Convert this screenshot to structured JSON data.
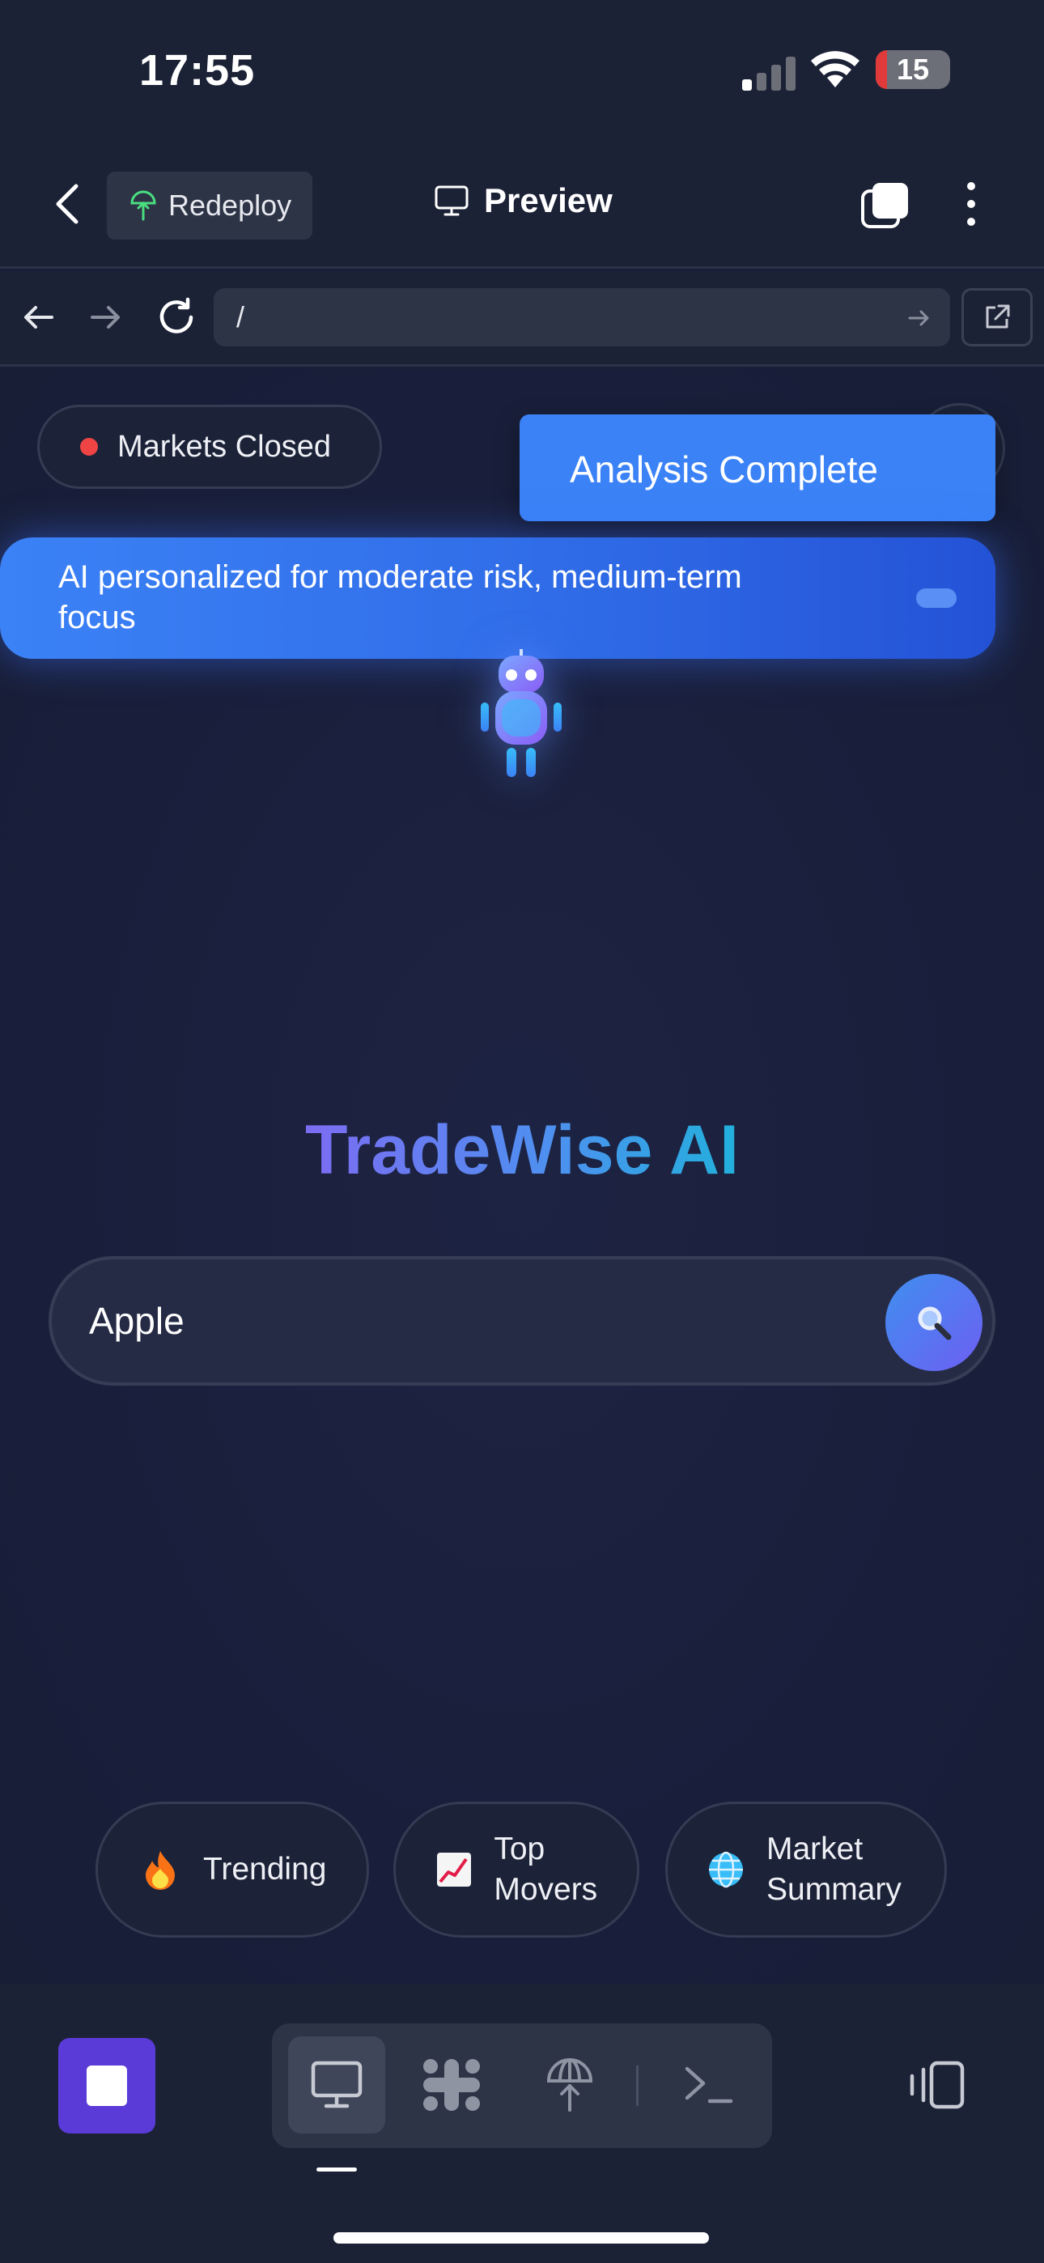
{
  "status_bar": {
    "time": "17:55",
    "battery_percent": "15"
  },
  "header": {
    "redeploy_label": "Redeploy",
    "preview_label": "Preview"
  },
  "url_bar": {
    "value": "/"
  },
  "market": {
    "status_label": "Markets Closed",
    "status_color": "#ef4444"
  },
  "toast": {
    "text": "Analysis Complete"
  },
  "banner": {
    "text": "AI personalized for moderate risk, medium-term focus"
  },
  "hero": {
    "title": "TradeWise AI"
  },
  "search": {
    "value": "Apple",
    "button_icon": "magnifier-icon"
  },
  "quick_actions": [
    {
      "icon": "fire-icon",
      "label": "Trending"
    },
    {
      "icon": "chart-icon",
      "label": "Top Movers"
    },
    {
      "icon": "globe-icon",
      "label": "Market Summary"
    }
  ],
  "toolbar": {
    "items": [
      "desktop-preview",
      "dots-grid",
      "deploy",
      "terminal"
    ],
    "active": "desktop-preview"
  },
  "colors": {
    "accent_blue": "#3b82f6",
    "stop_purple": "#5a3bd8",
    "background": "#181e35"
  }
}
